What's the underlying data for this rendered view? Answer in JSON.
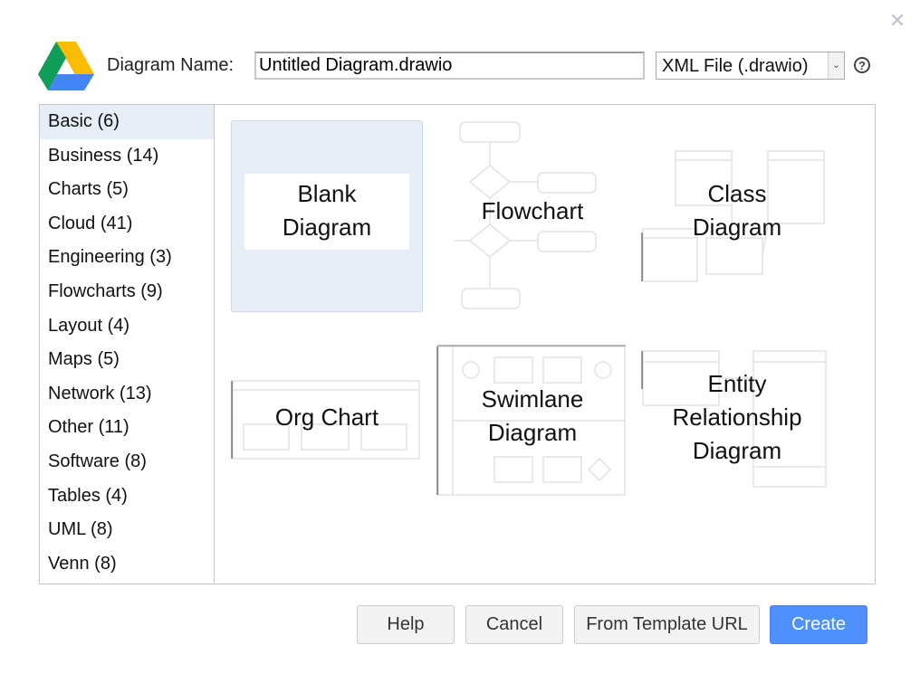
{
  "dialog": {
    "close_symbol": "✕",
    "name_label": "Diagram Name:",
    "name_value": "Untitled Diagram.drawio",
    "format_value": "XML File (.drawio)",
    "help_symbol": "?"
  },
  "categories": [
    {
      "label": "Basic (6)"
    },
    {
      "label": "Business (14)"
    },
    {
      "label": "Charts (5)"
    },
    {
      "label": "Cloud (41)"
    },
    {
      "label": "Engineering (3)"
    },
    {
      "label": "Flowcharts (9)"
    },
    {
      "label": "Layout (4)"
    },
    {
      "label": "Maps (5)"
    },
    {
      "label": "Network (13)"
    },
    {
      "label": "Other (11)"
    },
    {
      "label": "Software (8)"
    },
    {
      "label": "Tables (4)"
    },
    {
      "label": "UML (8)"
    },
    {
      "label": "Venn (8)"
    }
  ],
  "selected_category": "Basic (6)",
  "templates": {
    "blank": {
      "line1": "Blank",
      "line2": "Diagram"
    },
    "flowchart": {
      "line1": "Flowchart"
    },
    "class": {
      "line1": "Class",
      "line2": "Diagram"
    },
    "org": {
      "line1": "Org Chart"
    },
    "swimlane": {
      "line1": "Swimlane",
      "line2": "Diagram"
    },
    "er": {
      "line1": "Entity",
      "line2": "Relationship",
      "line3": "Diagram"
    }
  },
  "buttons": {
    "help": "Help",
    "cancel": "Cancel",
    "from_template_url": "From Template URL",
    "create": "Create"
  },
  "colors": {
    "accent": "#4d90fe",
    "selection": "#e8eef7"
  },
  "icons": [
    "google-drive-logo-icon",
    "close-icon",
    "chevron-down-icon",
    "help-icon"
  ]
}
